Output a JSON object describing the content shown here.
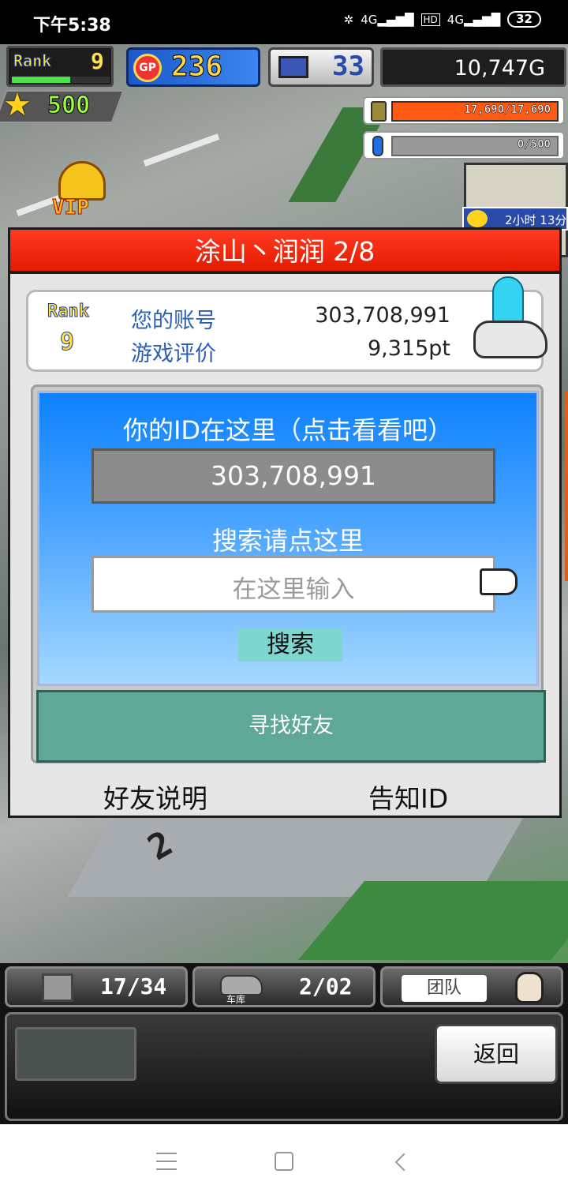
{
  "status_bar": {
    "time": "下午5:38",
    "network1": "4G",
    "hd": "HD",
    "network2": "4G",
    "battery": "32"
  },
  "hud": {
    "rank_label": "Rank",
    "rank_value": "9",
    "gp_label": "GP",
    "gp_value": "236",
    "pc_value": "33",
    "gold": "10,747G",
    "stars": "500",
    "fuel": "17,690/17,690",
    "gas": "0/500",
    "vip": "VIP",
    "timer": "2小时 13分"
  },
  "colors": {
    "accent_red": "#e51a00",
    "panel_blue": "#0d81ff",
    "button_teal": "#5fa796"
  },
  "dialog": {
    "title": "涂山丶润润 2/8",
    "card": {
      "rank_label": "Rank",
      "rank_value": "9",
      "account_label": "您的账号",
      "account_value": "303,708,991",
      "rating_label": "游戏评价",
      "rating_value": "9,315pt"
    },
    "id_prompt": "你的ID在这里（点击看看吧）",
    "id_value": "303,708,991",
    "search_prompt": "搜索请点这里",
    "search_placeholder": "在这里输入",
    "search_button": "搜索",
    "find_friends_button": "寻找好友",
    "friend_help": "好友说明",
    "share_id": "告知ID"
  },
  "bottom_hud": {
    "materials": "17/34",
    "garage": "2/02",
    "garage_label": "车库",
    "team_label": "团队",
    "back_button": "返回"
  },
  "navbar": {
    "icons": [
      "menu-icon",
      "home-icon",
      "back-icon"
    ]
  },
  "map": {
    "lot_number": "2"
  }
}
